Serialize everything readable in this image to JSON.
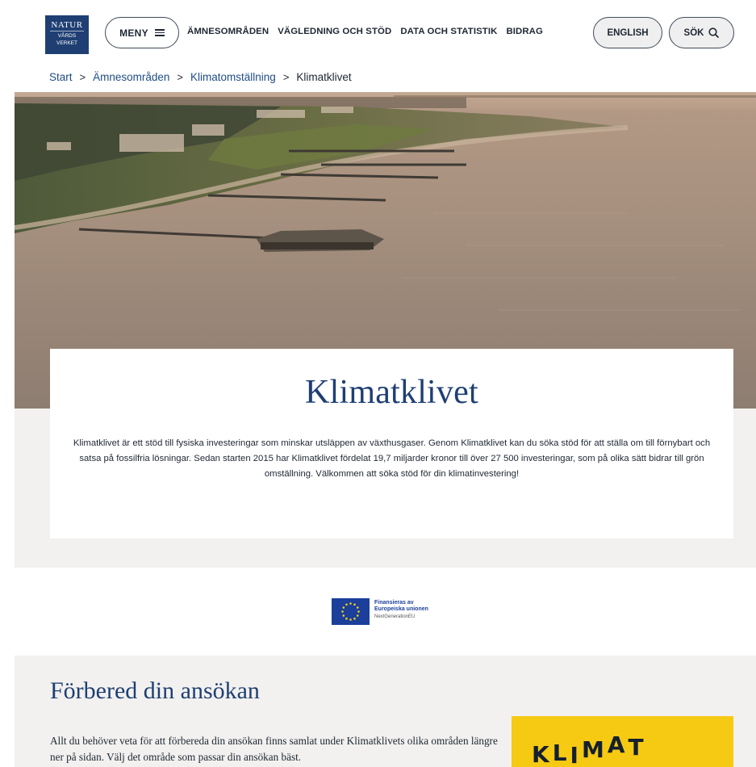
{
  "header": {
    "logo": {
      "line1": "NATUR",
      "line2": "VÅRDS",
      "line3": "VERKET"
    },
    "menu_label": "MENY",
    "nav": [
      "ÄMNESOMRÅDEN",
      "VÄGLEDNING OCH STÖD",
      "DATA OCH STATISTIK",
      "BIDRAG"
    ],
    "lang_label": "ENGLISH",
    "search_label": "SÖK"
  },
  "breadcrumb": {
    "items": [
      "Start",
      "Ämnesområden",
      "Klimatomställning"
    ],
    "current": "Klimatklivet"
  },
  "intro": {
    "title": "Klimatklivet",
    "text": "Klimatklivet är ett stöd till fysiska investeringar som minskar utsläppen av växthusgaser. Genom Klimatklivet kan du söka stöd för att ställa om till förnybart och satsa på fossilfria lösningar. Sedan starten 2015 har Klimatklivet fördelat 19,7 miljarder kronor till över 27 500 investeringar, som på olika sätt bidrar till grön omställning. Välkommen att söka stöd för din klimatinvestering!"
  },
  "eu_badge": {
    "line1": "Finansieras av",
    "line2": "Europeiska unionen",
    "line3": "NextGenerationEU"
  },
  "prepare": {
    "title": "Förbered din ansökan",
    "text": "Allt du behöver veta för att förbereda din ansökan finns samlat under Klimatklivets olika områden längre ner på sidan. Välj det område som passar din ansökan bäst.",
    "logo_letters": [
      "K",
      "L",
      "I",
      "M",
      "A",
      "T"
    ]
  },
  "colors": {
    "brand_blue": "#1f3f73",
    "eu_blue": "#1b3f9a",
    "klimat_yellow": "#f6c913",
    "band_grey": "#f2f1ef"
  },
  "icons": {
    "menu": "hamburger-icon",
    "search": "search-icon",
    "breadcrumb_separator": "chevron-right-icon"
  }
}
